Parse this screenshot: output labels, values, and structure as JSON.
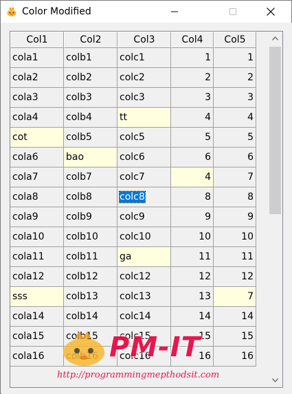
{
  "window": {
    "title": "Color Modified"
  },
  "table": {
    "columns": [
      "Col1",
      "Col2",
      "Col3",
      "Col4",
      "Col5"
    ],
    "rows": [
      [
        "cola1",
        "colb1",
        "colc1",
        "1",
        "1"
      ],
      [
        "cola2",
        "colb2",
        "colc2",
        "2",
        "2"
      ],
      [
        "cola3",
        "colb3",
        "colc3",
        "3",
        "3"
      ],
      [
        "cola4",
        "colb4",
        "tt",
        "4",
        "4"
      ],
      [
        "cot",
        "colb5",
        "colc5",
        "5",
        "5"
      ],
      [
        "cola6",
        "bao",
        "colc6",
        "6",
        "6"
      ],
      [
        "cola7",
        "colb7",
        "colc7",
        "4",
        "7"
      ],
      [
        "cola8",
        "colb8",
        "colc8",
        "8",
        "8"
      ],
      [
        "cola9",
        "colb9",
        "colc9",
        "9",
        "9"
      ],
      [
        "cola10",
        "colb10",
        "colc10",
        "10",
        "10"
      ],
      [
        "cola11",
        "colb11",
        "ga",
        "11",
        "11"
      ],
      [
        "cola12",
        "colb12",
        "colc12",
        "12",
        "12"
      ],
      [
        "sss",
        "colb13",
        "colc13",
        "13",
        "7"
      ],
      [
        "cola14",
        "colb14",
        "colc14",
        "14",
        "14"
      ],
      [
        "cola15",
        "colb15",
        "colc15",
        "15",
        "15"
      ],
      [
        "cola16",
        "colb16",
        "colc16",
        "16",
        "16"
      ]
    ],
    "modified_cells": [
      [
        3,
        2
      ],
      [
        4,
        0
      ],
      [
        5,
        1
      ],
      [
        6,
        3
      ],
      [
        10,
        2
      ],
      [
        12,
        0
      ],
      [
        12,
        4
      ]
    ],
    "selected_cell": [
      7,
      2
    ],
    "colors": {
      "modified": "#ffffe0",
      "selection": "#0078d7",
      "grid": "#a0a0a0",
      "background": "#f0f0f0"
    }
  },
  "scrollbar": {
    "position": 0.0
  },
  "watermark": {
    "brand": "PM-IT",
    "url": "http://programmingmepthodsit.com",
    "color": "#e8003c"
  }
}
